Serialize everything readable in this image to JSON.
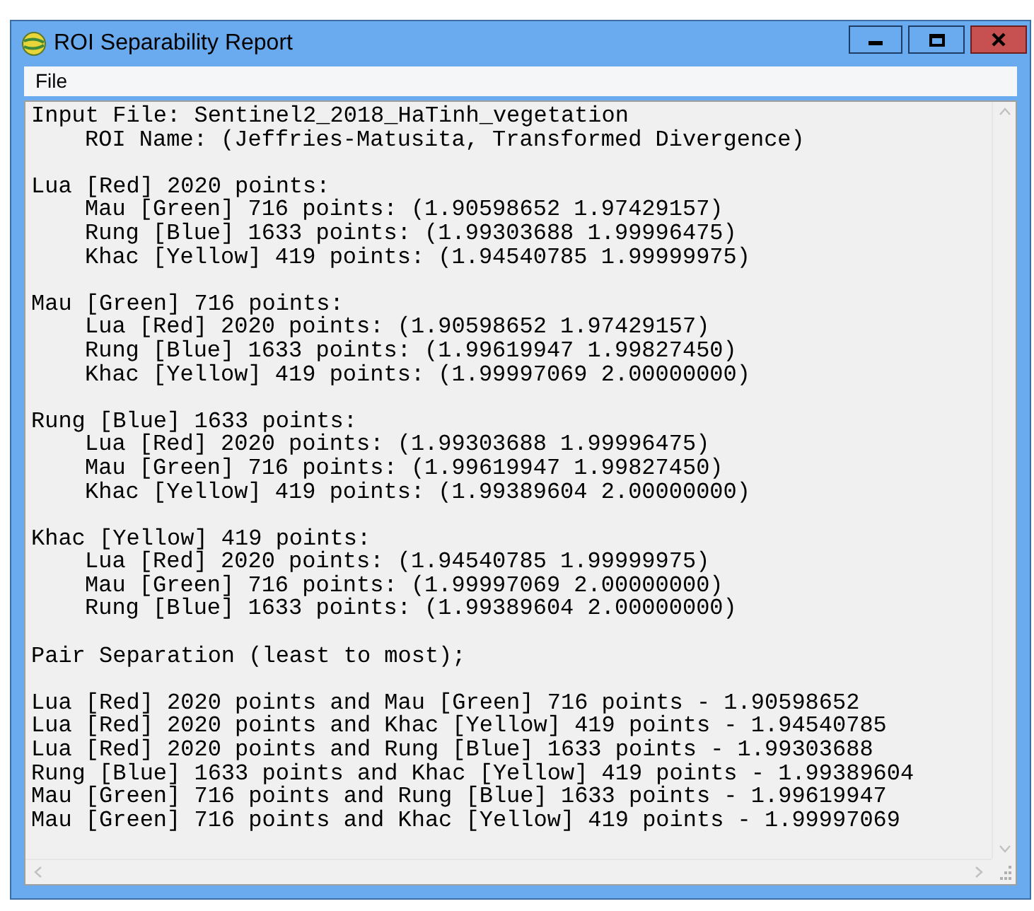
{
  "window": {
    "title": "ROI Separability Report"
  },
  "menu": [
    "File"
  ],
  "report": {
    "input_file": "Input File: Sentinel2_2018_HaTinh_vegetation",
    "roi_name": "ROI Name: (Jeffries-Matusita, Transformed Divergence)",
    "groups": [
      {
        "heading": "Lua [Red] 2020 points:",
        "pairs": [
          "Mau [Green] 716 points: (1.90598652 1.97429157)",
          "Rung [Blue] 1633 points: (1.99303688 1.99996475)",
          "Khac [Yellow] 419 points: (1.94540785 1.99999975)"
        ]
      },
      {
        "heading": "Mau [Green] 716 points:",
        "pairs": [
          "Lua [Red] 2020 points: (1.90598652 1.97429157)",
          "Rung [Blue] 1633 points: (1.99619947 1.99827450)",
          "Khac [Yellow] 419 points: (1.99997069 2.00000000)"
        ]
      },
      {
        "heading": "Rung [Blue] 1633 points:",
        "pairs": [
          "Lua [Red] 2020 points: (1.99303688 1.99996475)",
          "Mau [Green] 716 points: (1.99619947 1.99827450)",
          "Khac [Yellow] 419 points: (1.99389604 2.00000000)"
        ]
      },
      {
        "heading": "Khac [Yellow] 419 points:",
        "pairs": [
          "Lua [Red] 2020 points: (1.94540785 1.99999975)",
          "Mau [Green] 716 points: (1.99997069 2.00000000)",
          "Rung [Blue] 1633 points: (1.99389604 2.00000000)"
        ]
      }
    ],
    "pair_separation": {
      "title": "Pair Separation (least to most);",
      "pairs": [
        "Lua [Red] 2020 points and Mau [Green] 716 points - 1.90598652",
        "Lua [Red] 2020 points and Khac [Yellow] 419 points - 1.94540785",
        "Lua [Red] 2020 points and Rung [Blue] 1633 points - 1.99303688",
        "Rung [Blue] 1633 points and Khac [Yellow] 419 points - 1.99389604",
        "Mau [Green] 716 points and Rung [Blue] 1633 points - 1.99619947",
        "Mau [Green] 716 points and Khac [Yellow] 419 points - 1.99997069"
      ]
    }
  }
}
